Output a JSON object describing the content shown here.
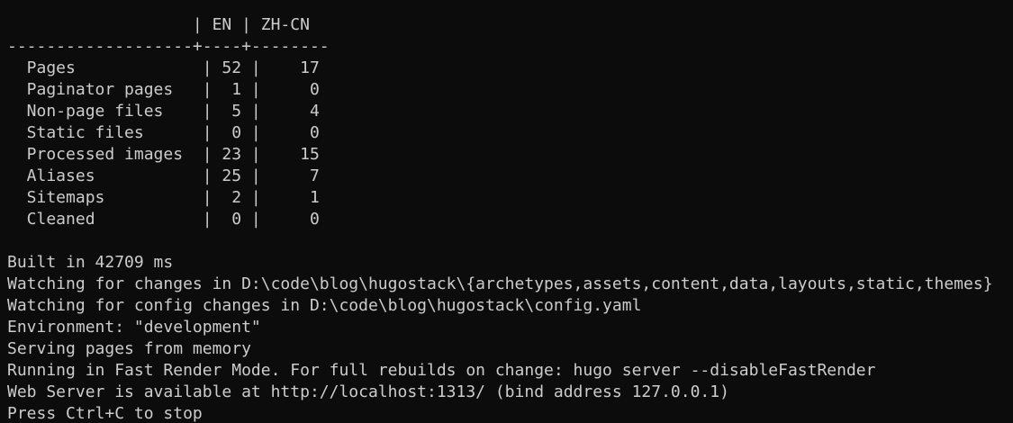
{
  "terminal": {
    "stats_table": {
      "header": "                   | EN | ZH-CN",
      "separator": "-------------------+----+--------",
      "rows": [
        "  Pages             | 52 |    17",
        "  Paginator pages   |  1 |     0",
        "  Non-page files    |  5 |     4",
        "  Static files      |  0 |     0",
        "  Processed images  | 23 |    15",
        "  Aliases           | 25 |     7",
        "  Sitemaps          |  2 |     1",
        "  Cleaned           |  0 |     0"
      ]
    },
    "log": [
      "Built in 42709 ms",
      "Watching for changes in D:\\code\\blog\\hugostack\\{archetypes,assets,content,data,layouts,static,themes}",
      "Watching for config changes in D:\\code\\blog\\hugostack\\config.yaml",
      "Environment: \"development\"",
      "Serving pages from memory",
      "Running in Fast Render Mode. For full rebuilds on change: hugo server --disableFastRender",
      "Web Server is available at http://localhost:1313/ (bind address 127.0.0.1)",
      "Press Ctrl+C to stop"
    ]
  }
}
